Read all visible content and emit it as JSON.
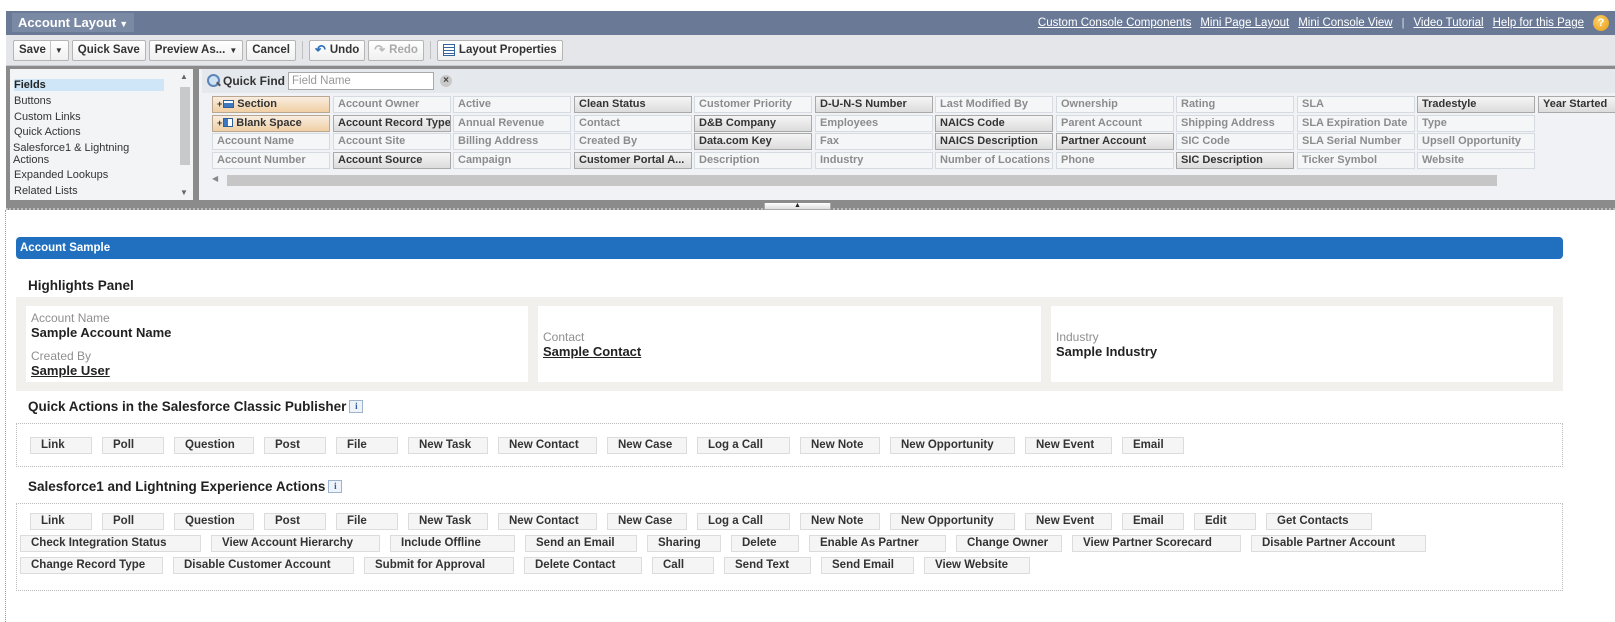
{
  "header": {
    "layout_title": "Account Layout",
    "links": [
      "Custom Console Components",
      "Mini Page Layout",
      "Mini Console View",
      "Video Tutorial",
      "Help for this Page"
    ],
    "separator": "|",
    "help_icon": "?"
  },
  "toolbar": {
    "save": "Save",
    "quick_save": "Quick Save",
    "preview_as": "Preview As...",
    "cancel": "Cancel",
    "undo": "Undo",
    "redo": "Redo",
    "layout_properties": "Layout Properties"
  },
  "palette": {
    "categories": [
      "Fields",
      "Buttons",
      "Custom Links",
      "Quick Actions",
      "Salesforce1 & Lightning Actions",
      "Expanded Lookups",
      "Related Lists"
    ],
    "active_category": "Fields",
    "quick_find_label": "Quick Find",
    "quick_find_placeholder": "Field Name",
    "quick_find_value": "",
    "columns": [
      [
        {
          "label": "Section",
          "state": "special",
          "icon": "section-icon"
        },
        {
          "label": "Blank Space",
          "state": "special",
          "icon": "blank-space-icon"
        },
        {
          "label": "Account Name",
          "state": "available"
        },
        {
          "label": "Account Number",
          "state": "available"
        }
      ],
      [
        {
          "label": "Account Owner",
          "state": "available"
        },
        {
          "label": "Account Record Type",
          "state": "used"
        },
        {
          "label": "Account Site",
          "state": "available"
        },
        {
          "label": "Account Source",
          "state": "used"
        }
      ],
      [
        {
          "label": "Active",
          "state": "available"
        },
        {
          "label": "Annual Revenue",
          "state": "available"
        },
        {
          "label": "Billing Address",
          "state": "available"
        },
        {
          "label": "Campaign",
          "state": "available"
        }
      ],
      [
        {
          "label": "Clean Status",
          "state": "used"
        },
        {
          "label": "Contact",
          "state": "available"
        },
        {
          "label": "Created By",
          "state": "available"
        },
        {
          "label": "Customer Portal A...",
          "state": "used"
        }
      ],
      [
        {
          "label": "Customer Priority",
          "state": "available"
        },
        {
          "label": "D&B Company",
          "state": "used"
        },
        {
          "label": "Data.com Key",
          "state": "used"
        },
        {
          "label": "Description",
          "state": "available"
        }
      ],
      [
        {
          "label": "D-U-N-S Number",
          "state": "used"
        },
        {
          "label": "Employees",
          "state": "available"
        },
        {
          "label": "Fax",
          "state": "available"
        },
        {
          "label": "Industry",
          "state": "available"
        }
      ],
      [
        {
          "label": "Last Modified By",
          "state": "available"
        },
        {
          "label": "NAICS Code",
          "state": "used"
        },
        {
          "label": "NAICS Description",
          "state": "used"
        },
        {
          "label": "Number of Locations",
          "state": "available"
        }
      ],
      [
        {
          "label": "Ownership",
          "state": "available"
        },
        {
          "label": "Parent Account",
          "state": "available"
        },
        {
          "label": "Partner Account",
          "state": "used"
        },
        {
          "label": "Phone",
          "state": "available"
        }
      ],
      [
        {
          "label": "Rating",
          "state": "available"
        },
        {
          "label": "Shipping Address",
          "state": "available"
        },
        {
          "label": "SIC Code",
          "state": "available"
        },
        {
          "label": "SIC Description",
          "state": "used"
        }
      ],
      [
        {
          "label": "SLA",
          "state": "available"
        },
        {
          "label": "SLA Expiration Date",
          "state": "available"
        },
        {
          "label": "SLA Serial Number",
          "state": "available"
        },
        {
          "label": "Ticker Symbol",
          "state": "available"
        }
      ],
      [
        {
          "label": "Tradestyle",
          "state": "used"
        },
        {
          "label": "Type",
          "state": "available"
        },
        {
          "label": "Upsell Opportunity",
          "state": "available"
        },
        {
          "label": "Website",
          "state": "available"
        }
      ],
      [
        {
          "label": "Year Started",
          "state": "used"
        }
      ]
    ]
  },
  "canvas": {
    "sample_title": "Account Sample",
    "highlights": {
      "title": "Highlights Panel",
      "boxes": [
        {
          "fields": [
            {
              "label": "Account Name",
              "value": "Sample Account Name",
              "link": false
            },
            {
              "label": "Created By",
              "value": "Sample User",
              "link": true
            }
          ]
        },
        {
          "fields": [
            {
              "label": "Contact",
              "value": "Sample Contact",
              "link": true
            }
          ]
        },
        {
          "fields": [
            {
              "label": "Industry",
              "value": "Sample Industry",
              "link": false
            }
          ]
        }
      ]
    },
    "classic_publisher": {
      "title": "Quick Actions in the Salesforce Classic Publisher",
      "info_icon": "i",
      "actions": [
        "Link",
        "Poll",
        "Question",
        "Post",
        "File",
        "New Task",
        "New Contact",
        "New Case",
        "Log a Call",
        "New Note",
        "New Opportunity",
        "New Event",
        "Email"
      ]
    },
    "lightning_actions": {
      "title": "Salesforce1 and Lightning Experience Actions",
      "info_icon": "i",
      "rows": [
        [
          "Link",
          "Poll",
          "Question",
          "Post",
          "File",
          "New Task",
          "New Contact",
          "New Case",
          "Log a Call",
          "New Note",
          "New Opportunity",
          "New Event",
          "Email",
          "Edit",
          "Get Contacts"
        ],
        [
          "Check Integration Status",
          "View Account Hierarchy",
          "Include Offline",
          "Send an Email",
          "Sharing",
          "Delete",
          "Enable As Partner",
          "Change Owner",
          "View Partner Scorecard",
          "Disable Partner Account"
        ],
        [
          "Change Record Type",
          "Disable Customer Account",
          "Submit for Approval",
          "Delete Contact",
          "Call",
          "Send Text",
          "Send Email",
          "View Website"
        ]
      ]
    }
  }
}
